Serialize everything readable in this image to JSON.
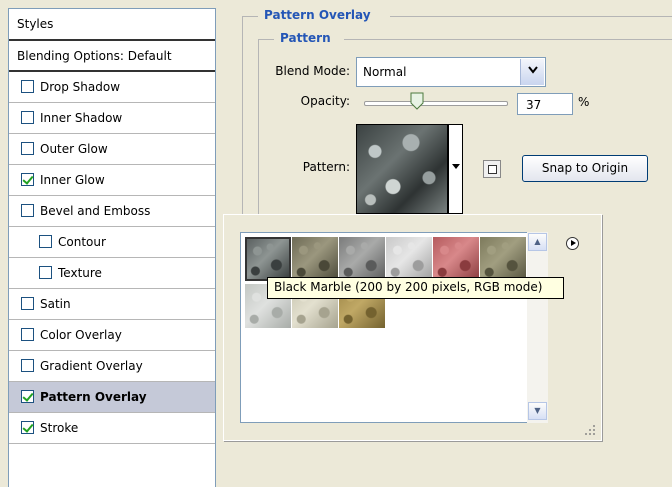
{
  "left_panel": {
    "header": "Styles",
    "blending": "Blending Options: Default",
    "items": [
      {
        "label": "Drop Shadow",
        "checked": false,
        "indent": false
      },
      {
        "label": "Inner Shadow",
        "checked": false,
        "indent": false
      },
      {
        "label": "Outer Glow",
        "checked": false,
        "indent": false
      },
      {
        "label": "Inner Glow",
        "checked": true,
        "indent": false
      },
      {
        "label": "Bevel and Emboss",
        "checked": false,
        "indent": false
      },
      {
        "label": "Contour",
        "checked": false,
        "indent": true
      },
      {
        "label": "Texture",
        "checked": false,
        "indent": true
      },
      {
        "label": "Satin",
        "checked": false,
        "indent": false
      },
      {
        "label": "Color Overlay",
        "checked": false,
        "indent": false
      },
      {
        "label": "Gradient Overlay",
        "checked": false,
        "indent": false
      },
      {
        "label": "Pattern Overlay",
        "checked": true,
        "indent": false,
        "selected": true
      },
      {
        "label": "Stroke",
        "checked": true,
        "indent": false
      }
    ]
  },
  "pattern_overlay": {
    "group_title": "Pattern Overlay",
    "subgroup_title": "Pattern",
    "blend_mode_label": "Blend Mode:",
    "blend_mode_value": "Normal",
    "opacity_label": "Opacity:",
    "opacity_value": "37",
    "opacity_unit": "%",
    "opacity_level": 0.37,
    "pattern_label": "Pattern:",
    "snap_button": "Snap to Origin"
  },
  "picker": {
    "tooltip": "Black Marble (200 by 200 pixels, RGB mode)",
    "patterns": [
      {
        "name": "black-marble",
        "colors": [
          "#5b6161",
          "#8e9593",
          "#3a3f3f"
        ]
      },
      {
        "name": "pebbles",
        "colors": [
          "#6d6a55",
          "#9b977e",
          "#4a4838"
        ]
      },
      {
        "name": "granite-gray",
        "colors": [
          "#7a7b7b",
          "#a9aaa9",
          "#5a5b5b"
        ]
      },
      {
        "name": "speckled-white",
        "colors": [
          "#c9c9c9",
          "#e6e6e6",
          "#9d9d9d"
        ]
      },
      {
        "name": "red-stone",
        "colors": [
          "#b55b5e",
          "#d8888a",
          "#8a3b3e"
        ]
      },
      {
        "name": "olive-stone",
        "colors": [
          "#7d7a5c",
          "#a19e80",
          "#55533e"
        ]
      },
      {
        "name": "light-marble",
        "colors": [
          "#c3c7c3",
          "#dfe1df",
          "#a8aca8"
        ]
      },
      {
        "name": "beige-rough",
        "colors": [
          "#c9c6b1",
          "#e3e0cf",
          "#a6a38f"
        ]
      },
      {
        "name": "burlap",
        "colors": [
          "#9d8647",
          "#c0a865",
          "#74622f"
        ]
      }
    ]
  }
}
